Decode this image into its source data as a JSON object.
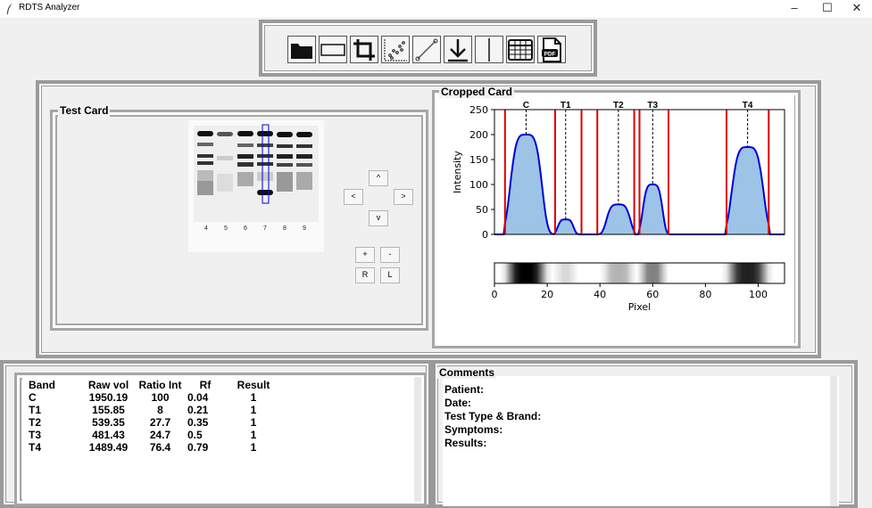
{
  "app": {
    "title": "RDTS Analyzer"
  },
  "window_controls": {
    "minimize": "–",
    "maximize": "☐",
    "close": "✕"
  },
  "toolbar": {
    "buttons": [
      {
        "name": "open-folder",
        "icon": "folder-icon"
      },
      {
        "name": "rectangle",
        "icon": "rectangle-icon"
      },
      {
        "name": "crop",
        "icon": "crop-icon"
      },
      {
        "name": "scatter",
        "icon": "scatter-plot-icon"
      },
      {
        "name": "line",
        "icon": "line-tool-icon"
      },
      {
        "name": "download",
        "icon": "download-icon"
      },
      {
        "name": "vertical-line",
        "icon": "vertical-line-icon"
      },
      {
        "name": "table",
        "icon": "table-icon"
      },
      {
        "name": "pdf",
        "icon": "pdf-icon",
        "label": "PDF"
      }
    ]
  },
  "test_card": {
    "legend": "Test Card",
    "lane_numbers": [
      "4",
      "5",
      "6",
      "7",
      "8",
      "9"
    ],
    "nav": {
      "up": "^",
      "left": "<",
      "right": ">",
      "down": "v",
      "plus": "+",
      "minus": "-",
      "r": "R",
      "l": "L"
    }
  },
  "cropped_card": {
    "legend": "Cropped Card"
  },
  "chart_data": {
    "type": "line",
    "xlabel": "Pixel",
    "ylabel": "Intensity",
    "xlim": [
      0,
      110
    ],
    "ylim": [
      0,
      250
    ],
    "xticks": [
      0,
      20,
      40,
      60,
      80,
      100
    ],
    "yticks": [
      0,
      50,
      100,
      150,
      200,
      250
    ],
    "peaks": [
      {
        "label": "C",
        "x": 12,
        "height": 200,
        "start": 4,
        "end": 23
      },
      {
        "label": "T1",
        "x": 27,
        "height": 30,
        "start": 23,
        "end": 33
      },
      {
        "label": "T2",
        "x": 47,
        "height": 60,
        "start": 39,
        "end": 53
      },
      {
        "label": "T3",
        "x": 60,
        "height": 100,
        "start": 55,
        "end": 66
      },
      {
        "label": "T4",
        "x": 96,
        "height": 175,
        "start": 88,
        "end": 104
      }
    ],
    "boundaries": [
      4,
      23,
      33,
      39,
      53,
      55,
      66,
      88,
      104
    ],
    "colors": {
      "curve": "#0000dd",
      "fill": "#9dc3e6",
      "boundary": "#dd0000"
    }
  },
  "results": {
    "headers": [
      "Band",
      "Raw vol",
      "Ratio Int",
      "Rf",
      "Result"
    ],
    "rows": [
      [
        "C",
        "1950.19",
        "100",
        "0.04",
        "1"
      ],
      [
        "T1",
        "155.85",
        "8",
        "0.21",
        "1"
      ],
      [
        "T2",
        "539.35",
        "27.7",
        "0.35",
        "1"
      ],
      [
        "T3",
        "481.43",
        "24.7",
        "0.5",
        "1"
      ],
      [
        "T4",
        "1489.49",
        "76.4",
        "0.79",
        "1"
      ]
    ]
  },
  "comments": {
    "legend": "Comments",
    "lines": [
      "Patient:",
      "Date:",
      "Test Type & Brand:",
      "Symptoms:",
      "Results:"
    ]
  }
}
